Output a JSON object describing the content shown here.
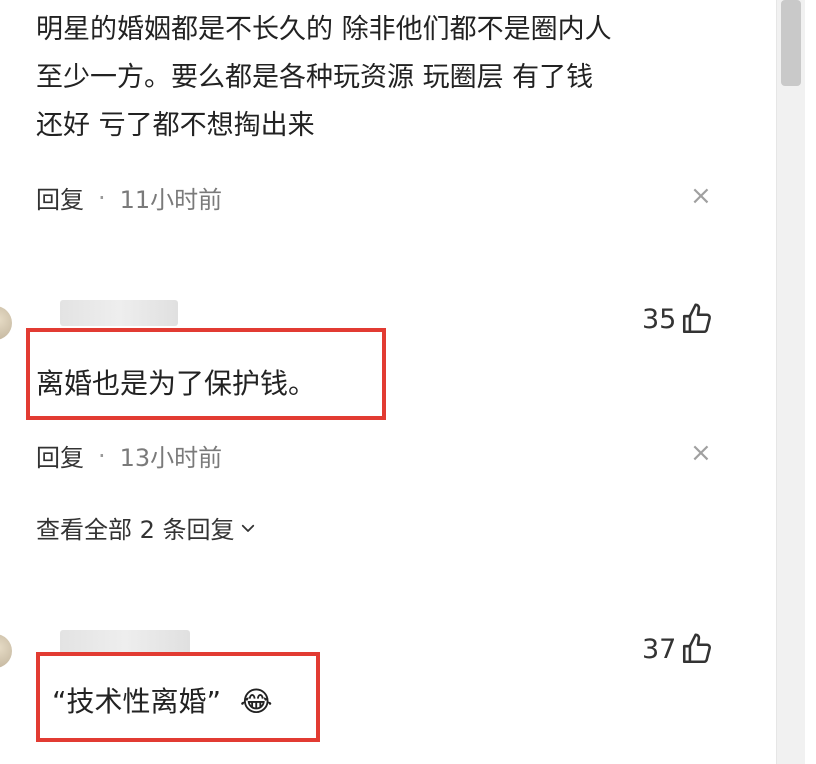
{
  "comment1": {
    "lines": [
      "明星的婚姻都是不长久的 除非他们都不是圈内人",
      "至少一方。要么都是各种玩资源 玩圈层 有了钱",
      "还好 亏了都不想掏出来"
    ],
    "reply_label": "回复",
    "separator": "·",
    "time": "11小时前",
    "close_symbol": "×"
  },
  "comment2": {
    "likes": "35",
    "text": "离婚也是为了保护钱。",
    "reply_label": "回复",
    "separator": "·",
    "time": "13小时前",
    "close_symbol": "×",
    "view_all_label": "查看全部 2 条回复"
  },
  "comment3": {
    "likes": "37",
    "text": "“技术性离婚”",
    "emoji": "😂"
  },
  "colors": {
    "highlight_box": "#e23b32",
    "meta_text": "#7a7a7a"
  }
}
